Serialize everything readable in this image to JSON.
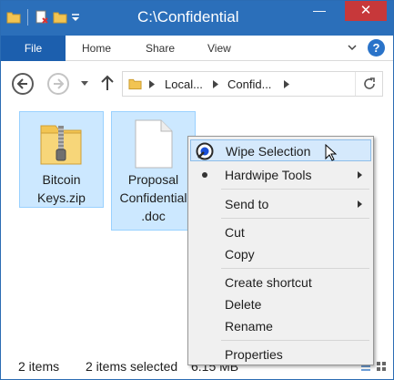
{
  "window": {
    "title": "C:\\Confidential",
    "min_label": "—",
    "max_label": "☐",
    "close_label": "✕"
  },
  "ribbon": {
    "tabs": [
      "File",
      "Home",
      "Share",
      "View"
    ],
    "help_label": "?"
  },
  "address": {
    "crumbs": [
      "Local...",
      "Confid..."
    ]
  },
  "files": [
    {
      "name_line1": "Bitcoin",
      "name_line2": "Keys.zip",
      "icon": "zip-folder-icon"
    },
    {
      "name_line1": "Proposal",
      "name_line2": "Confidential",
      "name_line3": ".doc",
      "icon": "document-icon"
    }
  ],
  "context_menu": {
    "items": [
      {
        "label": "Wipe Selection",
        "icon": "wipe-icon",
        "highlighted": true
      },
      {
        "label": "Hardwipe Tools",
        "submenu": true,
        "bullet": true
      },
      {
        "label": "Send to",
        "submenu": true
      },
      {
        "label": "Cut"
      },
      {
        "label": "Copy"
      },
      {
        "label": "Create shortcut"
      },
      {
        "label": "Delete"
      },
      {
        "label": "Rename"
      },
      {
        "label": "Properties"
      }
    ]
  },
  "status": {
    "item_count": "2 items",
    "selected": "2 items selected",
    "size": "6.15 MB"
  },
  "colors": {
    "titlebar": "#2b6fba",
    "file_tab": "#1c5fae",
    "close_button": "#c7383a",
    "selection": "#cce8ff",
    "menu_highlight": "#d5e9fc"
  }
}
